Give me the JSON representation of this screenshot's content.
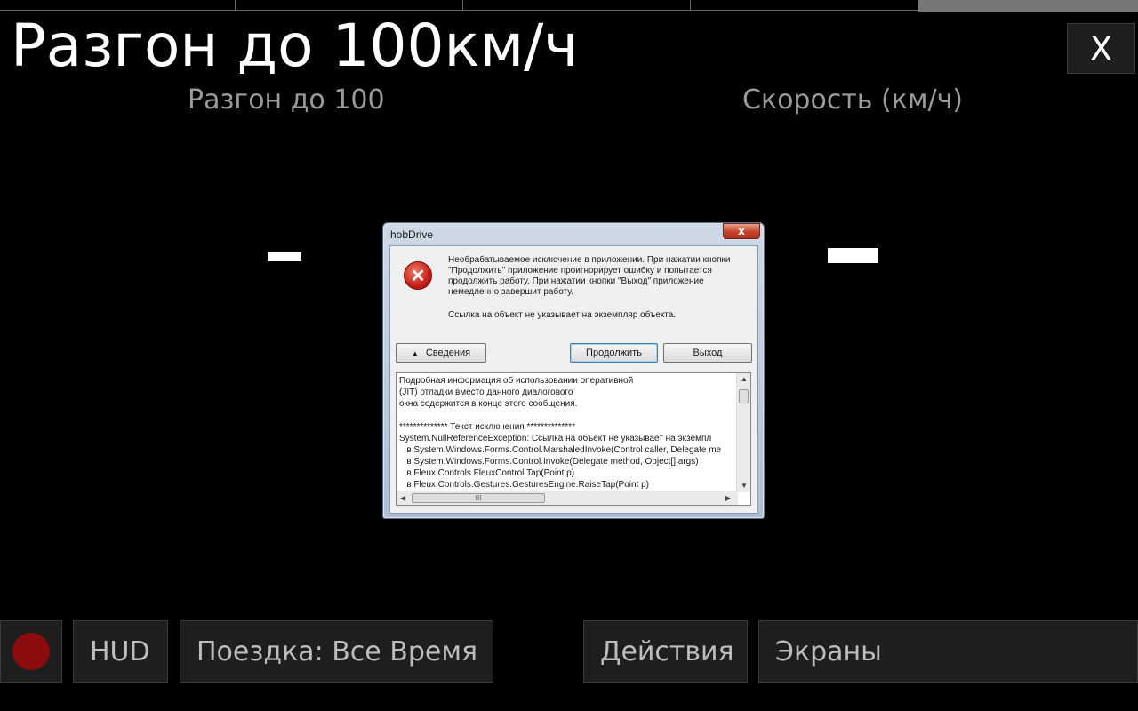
{
  "app": {
    "title": "Разгон до 100км/ч",
    "close_label": "X"
  },
  "columns": {
    "left_header": "Разгон до 100",
    "right_header": "Скорость (км/ч)"
  },
  "bottom_bar": {
    "hud_label": "HUD",
    "trip_label": "Поездка: Все Время",
    "actions_label": "Действия",
    "screens_label": "Экраны"
  },
  "dialog": {
    "title": "hobDrive",
    "close_glyph": "x",
    "message": "Необрабатываемое исключение в приложении. При нажатии кнопки \"Продолжить\" приложение проигнорирует ошибку и попытается продолжить работу. При нажатии кнопки \"Выход\" приложение немедленно завершит работу.",
    "message2": "Ссылка на объект не указывает на экземпляр объекта.",
    "details_button": "Сведения",
    "continue_button": "Продолжить",
    "exit_button": "Выход",
    "details_text": "Подробная информация об использовании оперативной\n(JIT) отладки вместо данного диалогового\nокна содержится в конце этого сообщения.\n\n************** Текст исключения **************\nSystem.NullReferenceException: Ссылка на объект не указывает на экземпл\n   в System.Windows.Forms.Control.MarshaledInvoke(Control caller, Delegate me\n   в System.Windows.Forms.Control.Invoke(Delegate method, Object[] args)\n   в Fleux.Controls.FleuxControl.Tap(Point p)\n   в Fleux.Controls.Gestures.GesturesEngine.RaiseTap(Point p)",
    "hscroll_grip": "III"
  },
  "icons": {
    "record": "record-icon",
    "error": "error-icon",
    "details_arrow": "triangle-up-icon"
  },
  "colors": {
    "background": "#000000",
    "record_dot": "#8b0c0c",
    "header_gray": "#9a9a9a"
  }
}
